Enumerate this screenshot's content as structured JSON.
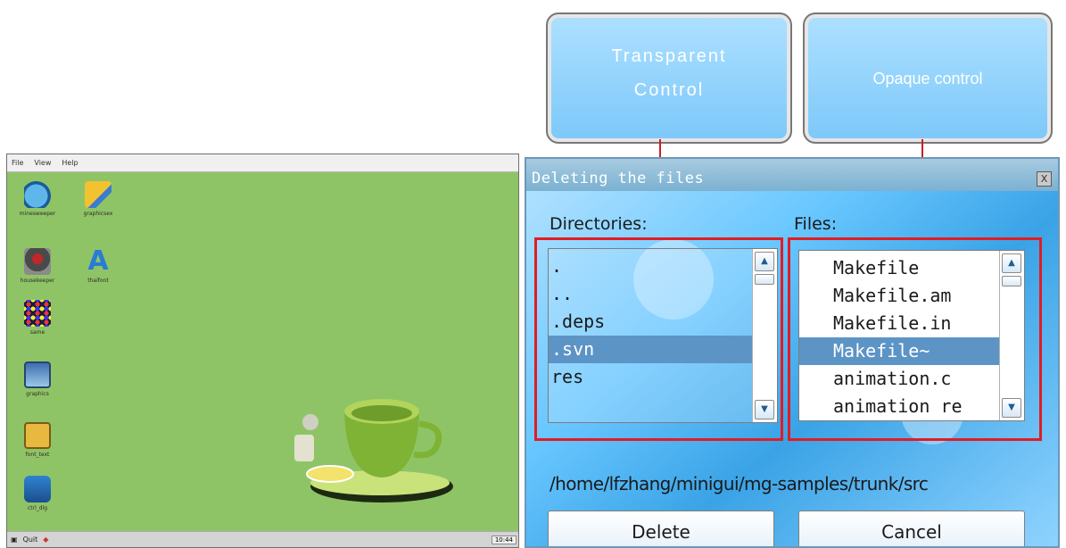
{
  "desktop": {
    "menu": [
      "File",
      "View",
      "Help"
    ],
    "icons": [
      {
        "name": "minesweeper",
        "label": "minesweeper",
        "icon": "bomb-icon"
      },
      {
        "name": "graphicsex",
        "label": "graphicsex",
        "icon": "pencil-icon"
      },
      {
        "name": "housekeeper",
        "label": "housekeeper",
        "icon": "joystick-icon"
      },
      {
        "name": "thaifont",
        "label": "thaifont",
        "icon": "letter-a-icon"
      },
      {
        "name": "same",
        "label": "same",
        "icon": "grid-balls-icon"
      },
      {
        "name": "graphics",
        "label": "graphics",
        "icon": "picture-icon"
      },
      {
        "name": "font-text",
        "label": "font_text",
        "icon": "fonts-icon"
      },
      {
        "name": "ctrl-dlg",
        "label": "ctrl_dlg",
        "icon": "dialog-icon"
      }
    ],
    "taskbar": {
      "start_text": "Quit",
      "clock": "10:44"
    }
  },
  "callouts": {
    "transparent": "Transparent Control",
    "opaque": "Opaque control"
  },
  "dialog": {
    "title": "Deleting the files",
    "close_label": "X",
    "directories_label": "Directories:",
    "files_label": "Files:",
    "directories": [
      ".",
      "..",
      ".deps",
      ".svn",
      "res"
    ],
    "directories_selected": ".svn",
    "files": [
      "Makefile",
      "Makefile.am",
      "Makefile.in",
      "Makefile~",
      "animation.c",
      "animation re"
    ],
    "files_selected": "Makefile~",
    "path": "/home/lfzhang/minigui/mg-samples/trunk/src",
    "delete_label": "Delete",
    "cancel_label": "Cancel"
  },
  "colors": {
    "desktop_bg": "#8fc466",
    "selection": "#5d94c6",
    "highlight_box": "#e11c24",
    "callout": "#7cc8fa"
  }
}
